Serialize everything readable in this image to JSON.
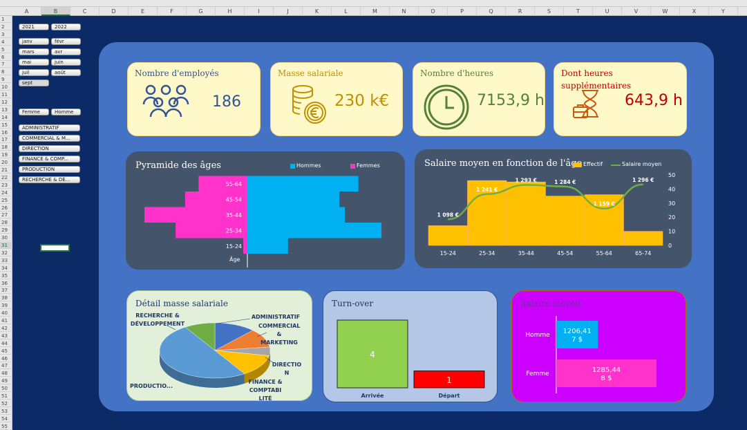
{
  "spreadsheet": {
    "columns": [
      "A",
      "B",
      "C",
      "D",
      "E",
      "F",
      "G",
      "H",
      "I",
      "J",
      "K",
      "L",
      "M",
      "N",
      "O",
      "P",
      "Q",
      "R",
      "S",
      "T",
      "U",
      "V",
      "W",
      "X",
      "Y"
    ],
    "rows": [
      "1",
      "2",
      "3",
      "4",
      "5",
      "6",
      "7",
      "8",
      "9",
      "10",
      "11",
      "12",
      "13",
      "14",
      "15",
      "16",
      "17",
      "18",
      "19",
      "20",
      "21",
      "22",
      "23",
      "24",
      "25",
      "26",
      "27",
      "28",
      "29",
      "30",
      "31",
      "32",
      "33",
      "34",
      "35",
      "36",
      "37",
      "38",
      "39",
      "40",
      "41",
      "42",
      "43",
      "44",
      "45",
      "46",
      "47",
      "48",
      "49",
      "50",
      "51",
      "52",
      "53",
      "54",
      "55"
    ],
    "selected_column": "B",
    "selected_row": "31"
  },
  "slicers": {
    "years": [
      "2021",
      "2022"
    ],
    "months": [
      "janv",
      "févr",
      "mars",
      "avr",
      "mai",
      "juin",
      "juil",
      "août",
      "sept"
    ],
    "gender": [
      "Femme",
      "Homme"
    ],
    "departments": [
      "ADMINISTRATIF",
      "COMMERCIAL & M...",
      "DIRECTION",
      "FINANCE & COMP...",
      "PRODUCTION",
      "RECHERCHE & DE..."
    ]
  },
  "kpis": {
    "employees": {
      "title": "Nombre d'employés",
      "value": "186",
      "icon": "people-group-icon",
      "color": "#2f5597"
    },
    "payroll": {
      "title": "Masse salariale",
      "value": "230 k€",
      "icon": "coins-euro-icon",
      "color": "#bf9000"
    },
    "hours": {
      "title": "Nombre d'heures",
      "value": "7153,9 h",
      "icon": "clock-icon",
      "color": "#548235"
    },
    "overtime": {
      "title": "Dont heures supplémentaires",
      "value": "643,9 h",
      "icon": "hourglass-briefcase-icon",
      "color": "#c00000"
    }
  },
  "pyramid": {
    "title": "Pyramide des âges",
    "legend_men": "Hommes",
    "legend_women": "Femmes",
    "axis_label": "Âge",
    "colors": {
      "men": "#00b0f0",
      "women": "#ff33cc"
    },
    "chart_data": {
      "type": "bar",
      "categories": [
        "15-24",
        "25-34",
        "35-44",
        "45-54",
        "55-64"
      ],
      "series": [
        {
          "name": "Hommes",
          "values": [
            30,
            99,
            72,
            68,
            82
          ]
        },
        {
          "name": "Femmes",
          "values": [
            3,
            53,
            76,
            46,
            36
          ]
        }
      ]
    }
  },
  "salary_age": {
    "title": "Salaire moyen en fonction de l'âge",
    "legend_bar": "Effectif",
    "legend_line": "Salaire moyen",
    "colors": {
      "bar": "#ffc000",
      "line": "#70ad47"
    },
    "chart_data": {
      "type": "bar",
      "categories": [
        "15-24",
        "25-34",
        "35-44",
        "45-54",
        "55-64",
        "65-74"
      ],
      "series": [
        {
          "name": "Effectif",
          "values": [
            14,
            46,
            45,
            35,
            36,
            10
          ]
        },
        {
          "name": "Salaire moyen",
          "values": [
            1098,
            1241,
            1293,
            1284,
            1159,
            1296
          ]
        }
      ],
      "data_labels": [
        "1 098 €",
        "1 241 €",
        "1 293 €",
        "1 284 €",
        "1 159 €",
        "1 296 €"
      ],
      "y_ticks": [
        "0",
        "10",
        "20",
        "30",
        "40",
        "50"
      ],
      "ylim": [
        0,
        50
      ],
      "line_range": [
        950,
        1350
      ]
    }
  },
  "payroll_detail": {
    "title": "Détail masse salariale",
    "chart_data": {
      "type": "pie",
      "labels": [
        "ADMINISTRATIF",
        "COMMERCIAL & MARKETING",
        "DIRECTION",
        "FINANCE & COMPTABILITÉ",
        "PRODUCTION",
        "RECHERCHE & DÉVELOPPEMENT"
      ],
      "values": [
        12,
        11,
        5,
        13,
        50,
        9
      ],
      "colors": [
        "#4472c4",
        "#ed7d31",
        "#a5a5a5",
        "#ffc000",
        "#5b9bd5",
        "#70ad47"
      ]
    },
    "label_texts": {
      "admin": "ADMINISTRATIF",
      "commercial": "COMMERCIAL\n&\nMARKETING",
      "direction": "DIRECTIO\nN",
      "finance": "FINANCE &\nCOMPTABI\nLITÉ",
      "production": "PRODUCTIO...",
      "rd": "RECHERCHE &\nDÉVELOPPEMENT"
    }
  },
  "turnover": {
    "title": "Turn-over",
    "chart_data": {
      "type": "bar",
      "categories": [
        "Arrivée",
        "Départ"
      ],
      "values": [
        4,
        1
      ],
      "ylim": [
        0,
        4
      ]
    },
    "colors": {
      "arrivals": "#92d050",
      "departures": "#ff0000"
    }
  },
  "avg_salary": {
    "title": "Salaire moyen",
    "chart_data": {
      "type": "bar",
      "categories": [
        "Homme",
        "Femme"
      ],
      "values": [
        1206.417,
        1285.448
      ],
      "value_labels": [
        "1206,41\n7 $",
        "1285,44\n8 $"
      ]
    },
    "colors": {
      "men": "#00b0f0",
      "women": "#ff33cc",
      "background": "#cc00ff"
    }
  }
}
